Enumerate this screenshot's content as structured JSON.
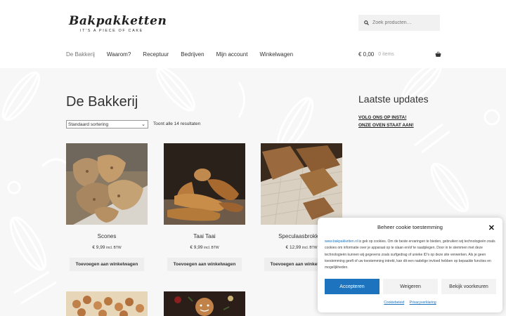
{
  "brand": {
    "logo_name": "Bakpakketten",
    "logo_tagline": "IT'S A PIECE OF CAKE"
  },
  "search": {
    "placeholder": "Zoek producten…"
  },
  "nav": {
    "items": [
      {
        "label": "De Bakkerij"
      },
      {
        "label": "Waarom?"
      },
      {
        "label": "Receptuur"
      },
      {
        "label": "Bedrijven"
      },
      {
        "label": "Mijn account"
      },
      {
        "label": "Winkelwagen"
      }
    ]
  },
  "cart": {
    "total": "€ 0,00",
    "items": "0 items",
    "icon": "basket-icon"
  },
  "shop": {
    "title": "De Bakkerij",
    "sort_value": "Standaard sortering",
    "result_count": "Toont alle 14 resultaten",
    "products": [
      {
        "name": "Scones",
        "price": "€ 9,99",
        "tax": "incl. BTW",
        "button": "Toevoegen aan winkelwagen"
      },
      {
        "name": "Taai Taai",
        "price": "€ 9,99",
        "tax": "incl. BTW",
        "button": "Toevoegen aan winkelwagen"
      },
      {
        "name": "Speculaasbrokken",
        "price": "€ 12,99",
        "tax": "incl. BTW",
        "button": "Toevoegen aan winkelwagen"
      }
    ]
  },
  "sidebar": {
    "title": "Laatste updates",
    "links": [
      {
        "label": "VOLG ONS OP INSTA!"
      },
      {
        "label": "ONZE OVEN STAAT AAN!"
      }
    ]
  },
  "cookie": {
    "title": "Beheer cookie toestemming",
    "site": "www.bakpakketten.nl",
    "text": " is gek op cookies. Om de beste ervaringen te bieden, gebruiken wij technologieën zoals cookies om informatie over je apparaat op te slaan en/of te raadplegen. Door in te stemmen met deze technologieën kunnen wij gegevens zoals surfgedrag of unieke ID's op deze site verwerken. Als je geen toestemming geeft of uw toestemming intrekt, kan dit een nadelige invloed hebben op bepaalde functies en mogelijkheden.",
    "accept": "Accepteren",
    "deny": "Weigeren",
    "prefs": "Bekijk voorkeuren",
    "link_policy": "Cookiebeleid",
    "link_privacy": "Privacyverklaring"
  },
  "colors": {
    "accent": "#1e73be",
    "background": "#f7f7f7"
  }
}
